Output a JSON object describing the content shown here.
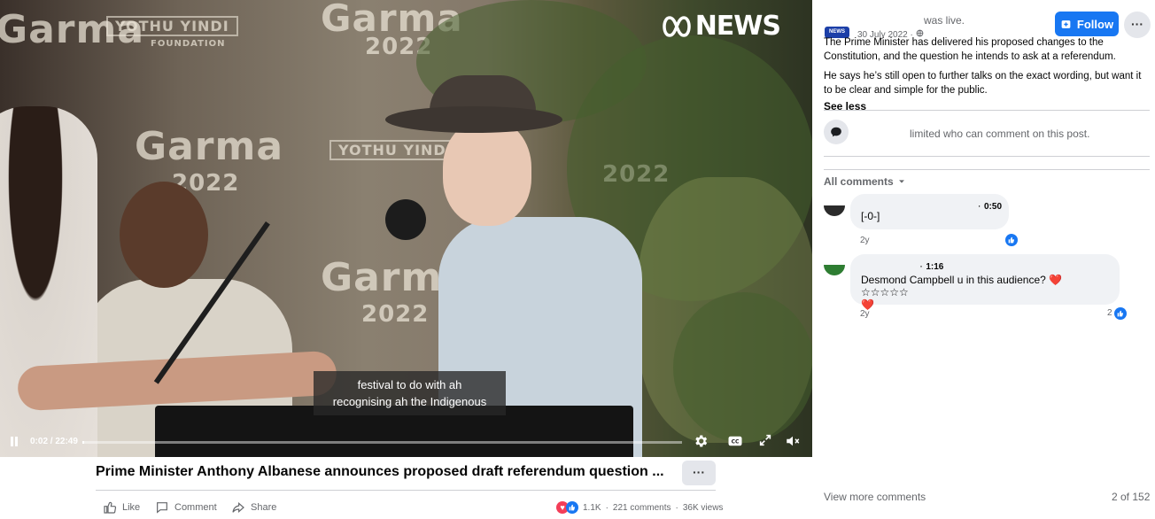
{
  "video": {
    "logo_text": "NEWS",
    "logo_mark": "abc-logo",
    "backdrop": {
      "event": "Garma",
      "year": "2022",
      "banner": "YOTHU YINDI",
      "banner_sub": "FOUNDATION"
    },
    "subtitle_lines": [
      "festival to do with ah",
      "recognising ah the Indigenous"
    ],
    "time": "0:02 / 22:49",
    "progress": 0.0015,
    "icons": {
      "play": "pause-icon",
      "settings": "gear-icon",
      "cc": "closed-captions-icon",
      "fullscreen": "fullscreen-icon",
      "volume": "muted-volume-icon"
    }
  },
  "title": "Prime Minister Anthony Albanese announces proposed draft referendum question ...",
  "title_more": "···",
  "actions": {
    "like": "Like",
    "comment": "Comment",
    "share": "Share"
  },
  "stats": {
    "reactions_count": "1.1K",
    "comments": "221 comments",
    "views": "36K views"
  },
  "panel": {
    "page_badge": "NEWS",
    "live_text": "was live.",
    "date": "30 July 2022 · ",
    "follow_label": "Follow",
    "more": "···",
    "post_paragraphs": [
      "The Prime Minister has delivered his proposed changes to the Constitution, and the question he intends to ask at a referendum.",
      "He says he’s still open to further talks on the exact wording, but want it to be clear and simple for the public."
    ],
    "see_less": "See less",
    "restricted_text": "limited who can comment on this post.",
    "all_comments": "All comments",
    "comments": [
      {
        "timestamp": "0:50",
        "text": "[-0-]",
        "age": "2y",
        "likes": ""
      },
      {
        "timestamp": "1:16",
        "text_line1": "Desmond Campbell u in this audience? ❤️ ☆☆☆☆☆",
        "text_line2": "❤️",
        "age": "2y",
        "likes": "2"
      }
    ],
    "view_more": "View more comments",
    "count": "2 of 152"
  },
  "colors": {
    "accent": "#1877f2",
    "text_secondary": "#65676b",
    "bubble": "#f0f2f5",
    "love": "#f33e58"
  }
}
